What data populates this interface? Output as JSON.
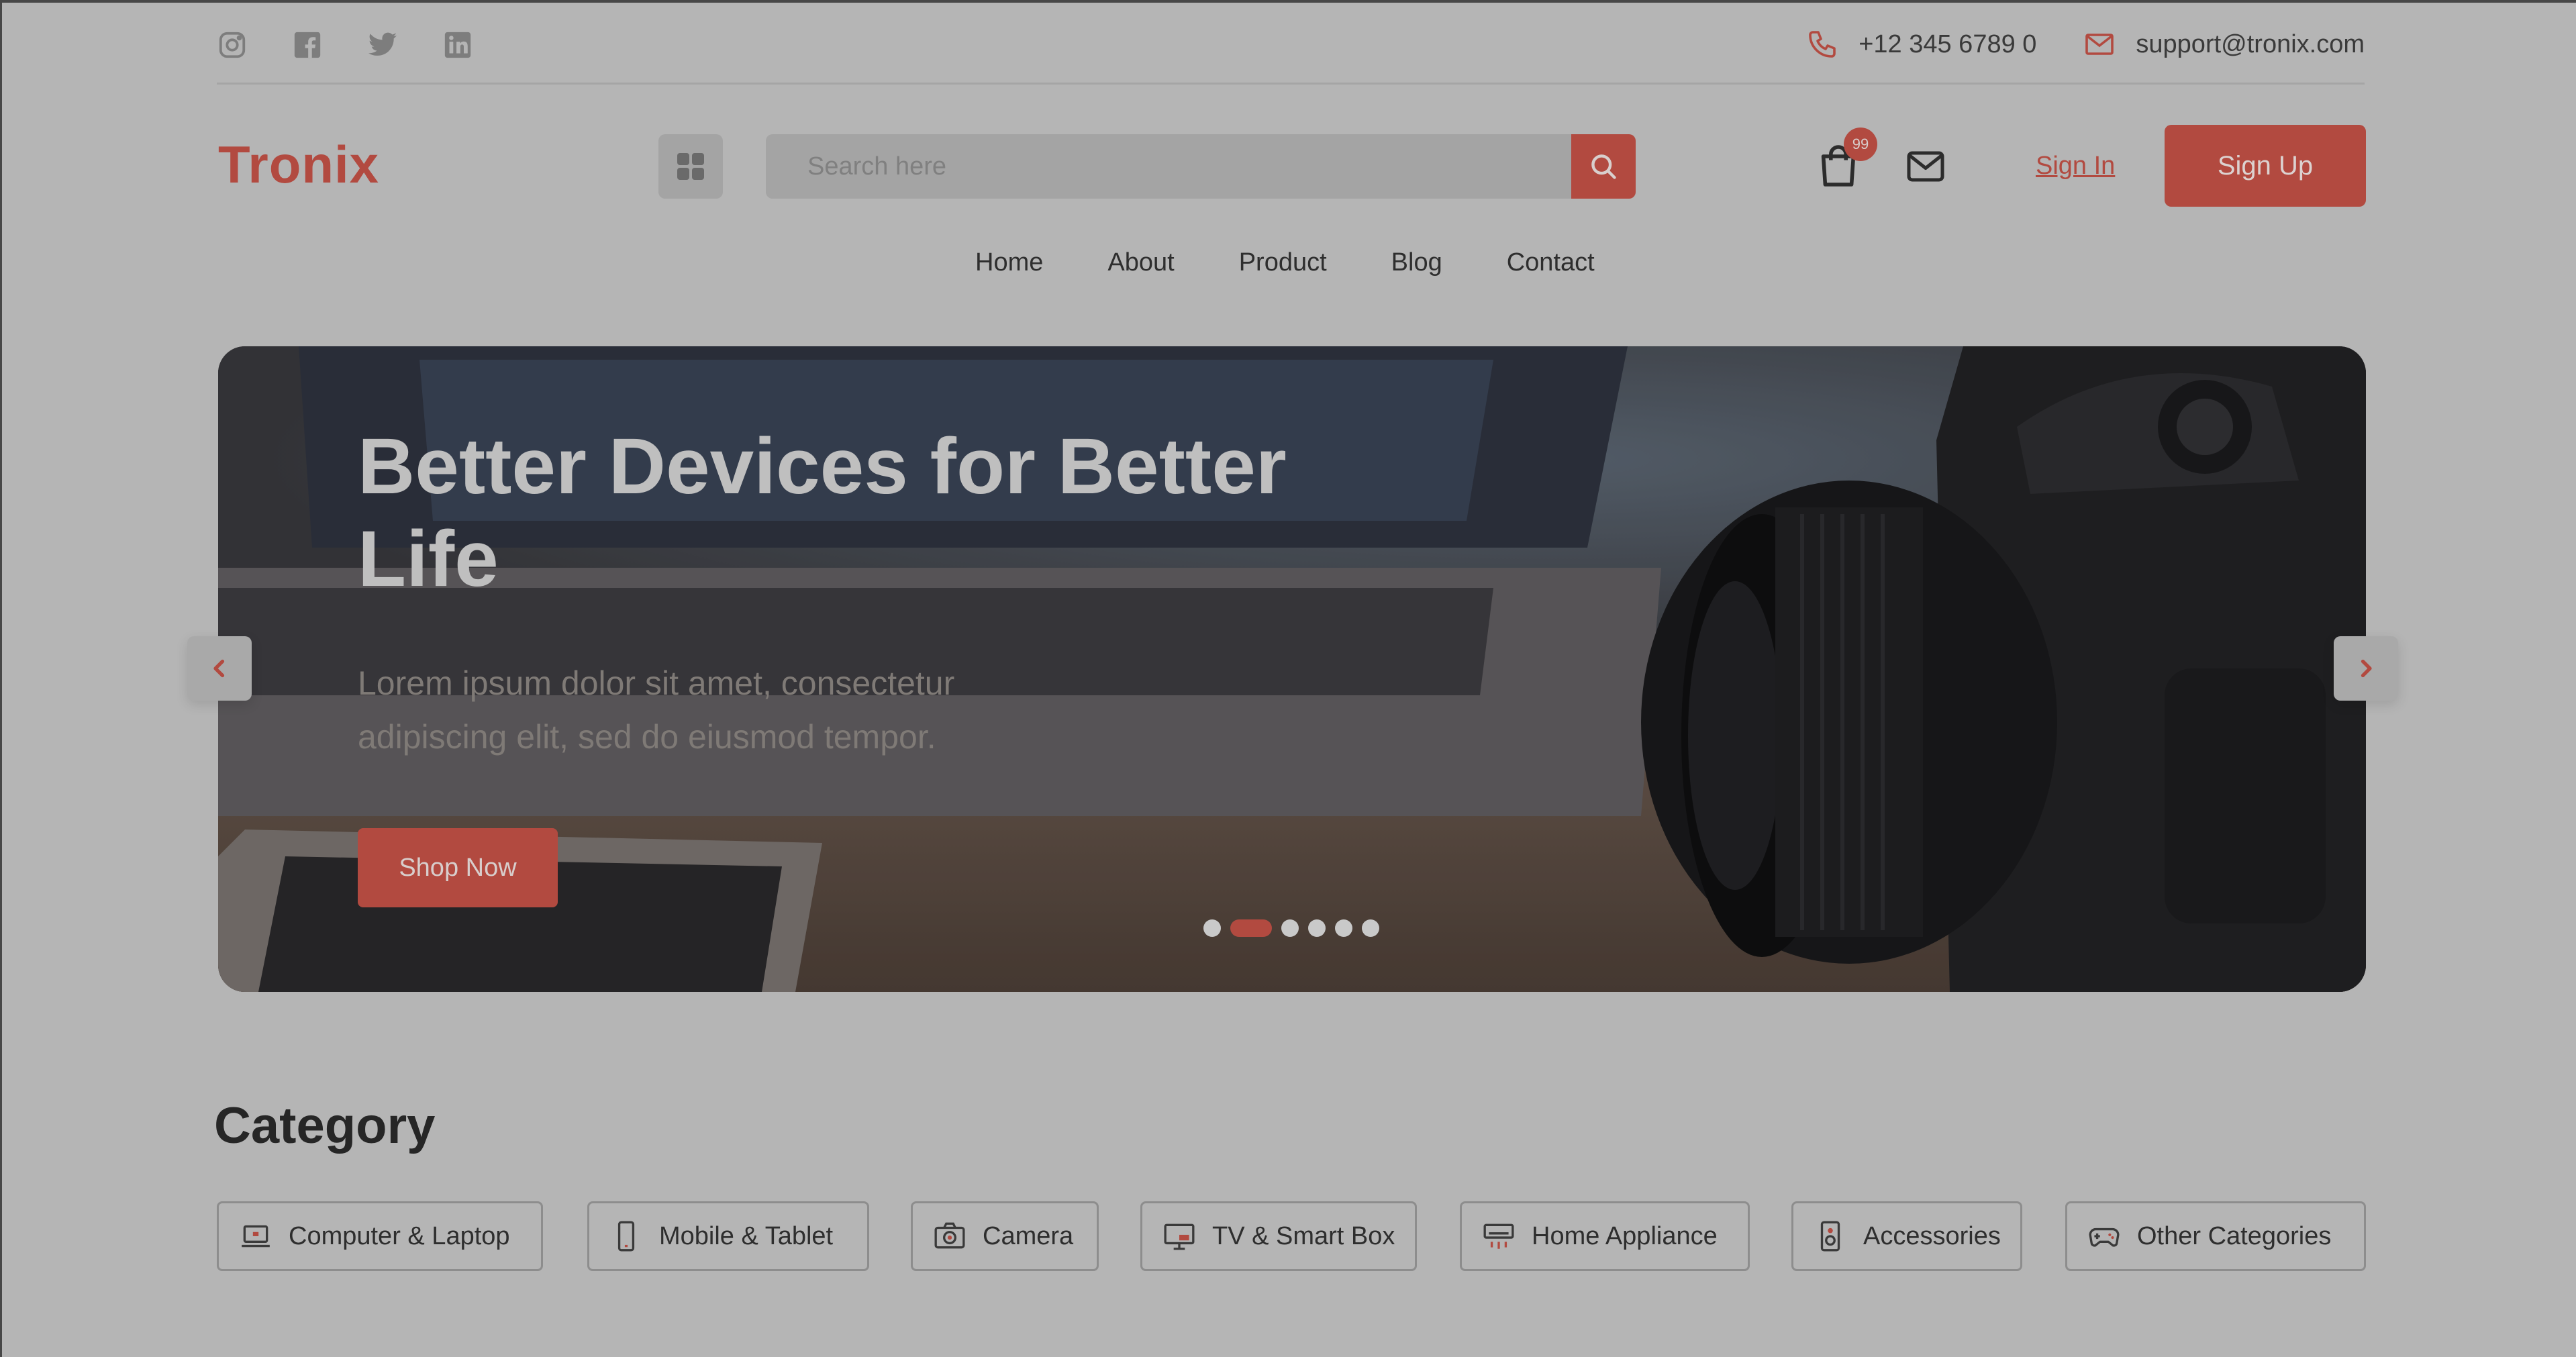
{
  "topbar": {
    "social": [
      "instagram-icon",
      "facebook-icon",
      "twitter-icon",
      "linkedin-icon"
    ],
    "phone": "+12 345 6789 0",
    "email": "support@tronix.com"
  },
  "header": {
    "logo": "Tronix",
    "search_placeholder": "Search here",
    "cart_count": "99",
    "signin": "Sign In",
    "signup": "Sign Up"
  },
  "nav": [
    "Home",
    "About",
    "Product",
    "Blog",
    "Contact"
  ],
  "hero": {
    "title": "Better Devices for Better Life",
    "subtitle": "Lorem ipsum dolor sit amet, consectetur adipiscing elit, sed do eiusmod tempor.",
    "cta": "Shop Now",
    "slides_total": 6,
    "active_slide": 2
  },
  "category": {
    "title": "Category",
    "items": [
      {
        "label": "Computer & Laptop",
        "icon": "laptop-icon"
      },
      {
        "label": "Mobile & Tablet",
        "icon": "mobile-icon"
      },
      {
        "label": "Camera",
        "icon": "camera-icon"
      },
      {
        "label": "TV & Smart Box",
        "icon": "tv-icon"
      },
      {
        "label": "Home Appliance",
        "icon": "air-conditioner-icon"
      },
      {
        "label": "Accessories",
        "icon": "speaker-icon"
      },
      {
        "label": "Other Categories",
        "icon": "gamepad-icon"
      }
    ]
  },
  "colors": {
    "accent": "#b24a40",
    "background": "#b5b5b5",
    "text": "#2e2e2e"
  }
}
